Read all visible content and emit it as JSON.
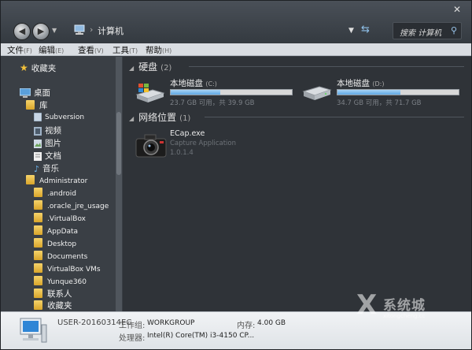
{
  "window": {
    "address": "计算机",
    "search_placeholder": "搜索 计算机"
  },
  "menu": [
    {
      "label": "文件",
      "acc": "(F)"
    },
    {
      "label": "编辑",
      "acc": "(E)"
    },
    {
      "label": "查看",
      "acc": "(V)"
    },
    {
      "label": "工具",
      "acc": "(T)"
    },
    {
      "label": "帮助",
      "acc": "(H)"
    }
  ],
  "sidebar": {
    "favorites": "收藏夹",
    "desktop": "桌面",
    "library": "库",
    "libs": [
      "Subversion",
      "视频",
      "图片",
      "文档",
      "音乐"
    ],
    "user": "Administrator",
    "user_folders": [
      ".android",
      ".oracle_jre_usage",
      ".VirtualBox",
      "AppData",
      "Desktop",
      "Documents",
      "VirtualBox VMs",
      "Yunque360",
      "联系人",
      "收藏夹"
    ]
  },
  "content": {
    "disks_header": "硬盘",
    "disks_count": "(2)",
    "drives": [
      {
        "name": "本地磁盘",
        "letter": "(C:)",
        "free": "23.7 GB 可用，共 39.9 GB",
        "used_fraction": 0.41
      },
      {
        "name": "本地磁盘",
        "letter": "(D:)",
        "free": "34.7 GB 可用，共 71.7 GB",
        "used_fraction": 0.52
      }
    ],
    "network_header": "网络位置",
    "network_count": "(1)",
    "app": {
      "name": "ECap.exe",
      "desc": "Capture Application",
      "version": "1.0.1.4"
    }
  },
  "details": {
    "computer_name": "USER-20160314EC",
    "workgroup_label": "工作组:",
    "workgroup_value": "WORKGROUP",
    "memory_label": "内存:",
    "memory_value": "4.00 GB",
    "cpu_label": "处理器:",
    "cpu_value": "Intel(R) Core(TM) i3-4150 CP..."
  },
  "watermark": {
    "text": "系统城",
    "sub": "xitongcheng.cc"
  }
}
